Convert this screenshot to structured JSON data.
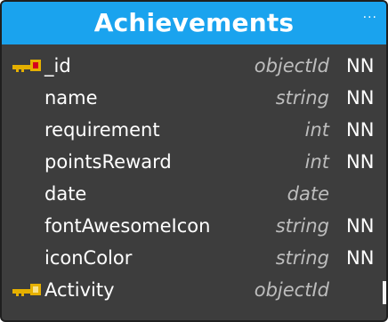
{
  "entity": {
    "title": "Achievements",
    "menu": "···",
    "header_color": "#1aa3ee",
    "body_color": "#3d3d3d",
    "fields": [
      {
        "name": "_id",
        "type": "objectId",
        "nn": "NN",
        "key": "primary-key-icon"
      },
      {
        "name": "name",
        "type": "string",
        "nn": "NN",
        "key": ""
      },
      {
        "name": "requirement",
        "type": "int",
        "nn": "NN",
        "key": ""
      },
      {
        "name": "pointsReward",
        "type": "int",
        "nn": "NN",
        "key": ""
      },
      {
        "name": "date",
        "type": "date",
        "nn": "",
        "key": ""
      },
      {
        "name": "fontAwesomeIcon",
        "type": "string",
        "nn": "NN",
        "key": ""
      },
      {
        "name": "iconColor",
        "type": "string",
        "nn": "NN",
        "key": ""
      },
      {
        "name": "Activity",
        "type": "objectId",
        "nn": "",
        "key": "foreign-key-icon"
      }
    ]
  }
}
